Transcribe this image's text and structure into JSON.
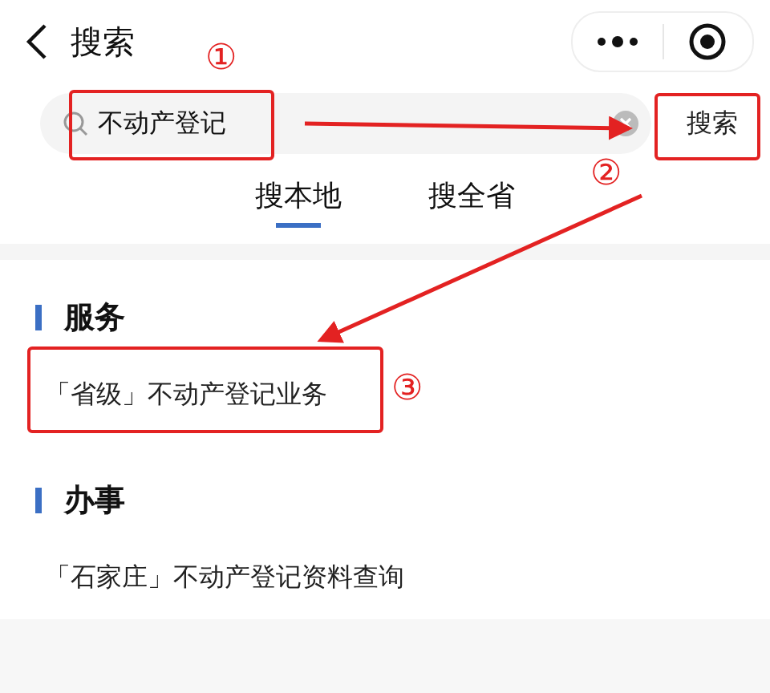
{
  "header": {
    "title": "搜索"
  },
  "search": {
    "value": "不动产登记",
    "button": "搜索"
  },
  "tabs": [
    {
      "label": "搜本地",
      "selected": true
    },
    {
      "label": "搜全省",
      "selected": false
    }
  ],
  "sections": [
    {
      "title": "服务",
      "items": [
        "「省级」不动产登记业务"
      ]
    },
    {
      "title": "办事",
      "items": [
        "「石家庄」不动产登记资料查询"
      ]
    }
  ],
  "annotations": [
    "①",
    "②",
    "③"
  ]
}
